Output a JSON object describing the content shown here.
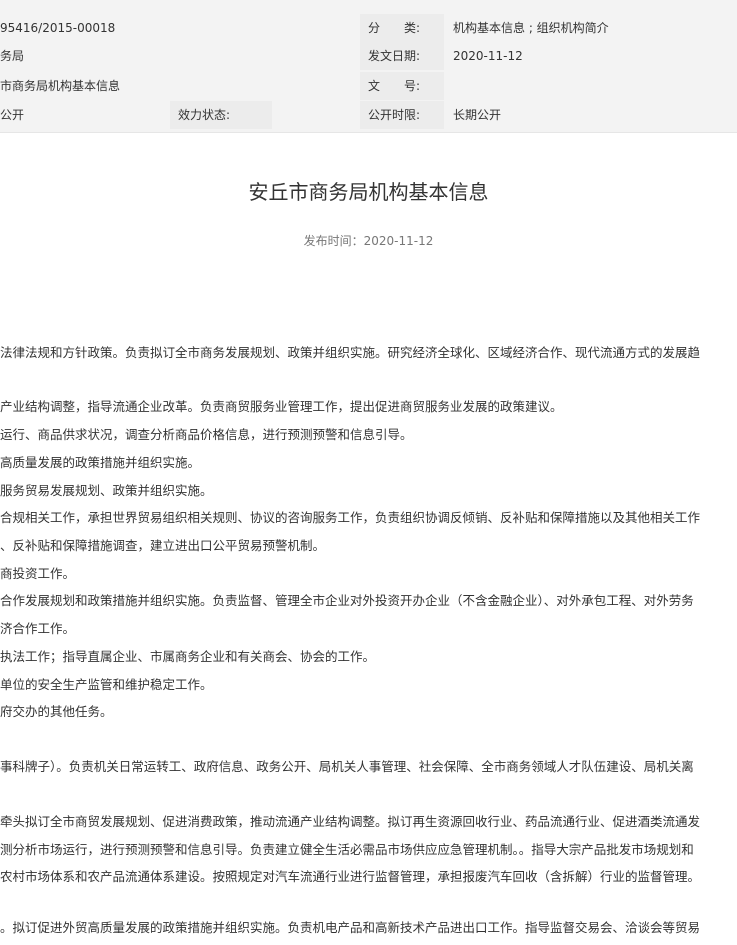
{
  "meta": {
    "index_no": "95416/2015-00018",
    "issuer_fragment": "务局",
    "name_fragment": "市商务局机构基本信息",
    "open_mode_fragment": "公开",
    "validity_label": "效力状态:",
    "category_label": "分　　类:",
    "category_value": "机构基本信息 ; 组织机构简介",
    "issue_date_label": "发文日期:",
    "issue_date_value": "2020-11-12",
    "doc_no_label": "文　　号:",
    "doc_no_value": "",
    "open_scope_label": "公开时限:",
    "open_scope_value": "长期公开"
  },
  "article": {
    "title": "安丘市商务局机构基本信息",
    "publish_time": "发布时间：2020-11-12",
    "lines": [
      "法律法规和方针政策。负责拟订全市商务发展规划、政策并组织实施。研究经济全球化、区域经济合作、现代流通方式的发展趋",
      "产业结构调整，指导流通企业改革。负责商贸服务业管理工作，提出促进商贸服务业发展的政策建议。",
      "运行、商品供求状况，调查分析商品价格信息，进行预测预警和信息引导。",
      "高质量发展的政策措施并组织实施。",
      "服务贸易发展规划、政策并组织实施。",
      "合规相关工作，承担世界贸易组织相关规则、协议的咨询服务工作，负责组织协调反倾销、反补贴和保障措施以及其他相关工作",
      "、反补贴和保障措施调查，建立进出口公平贸易预警机制。",
      "商投资工作。",
      "合作发展规划和政策措施并组织实施。负责监督、管理全市企业对外投资开办企业（不含金融企业）、对外承包工程、对外劳务",
      "济合作工作。",
      "执法工作；指导直属企业、市属商务企业和有关商会、协会的工作。",
      "单位的安全生产监管和维护稳定工作。",
      "府交办的其他任务。",
      "事科牌子）。负责机关日常运转工、政府信息、政务公开、局机关人事管理、社会保障、全市商务领域人才队伍建设、局机关离",
      "牵头拟订全市商贸发展规划、促进消费政策，推动流通产业结构调整。拟订再生资源回收行业、药品流通行业、促进酒类流通发",
      "测分析市场运行，进行预测预警和信息引导。负责建立健全生活必需品市场供应应急管理机制。。指导大宗产品批发市场规划和",
      "农村市场体系和农产品流通体系建设。按照规定对汽车流通行业进行监督管理，承担报废汽车回收（含拆解）行业的监督管理。",
      "。拟订促进外贸高质量发展的政策措施并组织实施。负责机电产品和高新技术产品进出口工作。指导监督交易会、洽谈会等贸易"
    ]
  }
}
